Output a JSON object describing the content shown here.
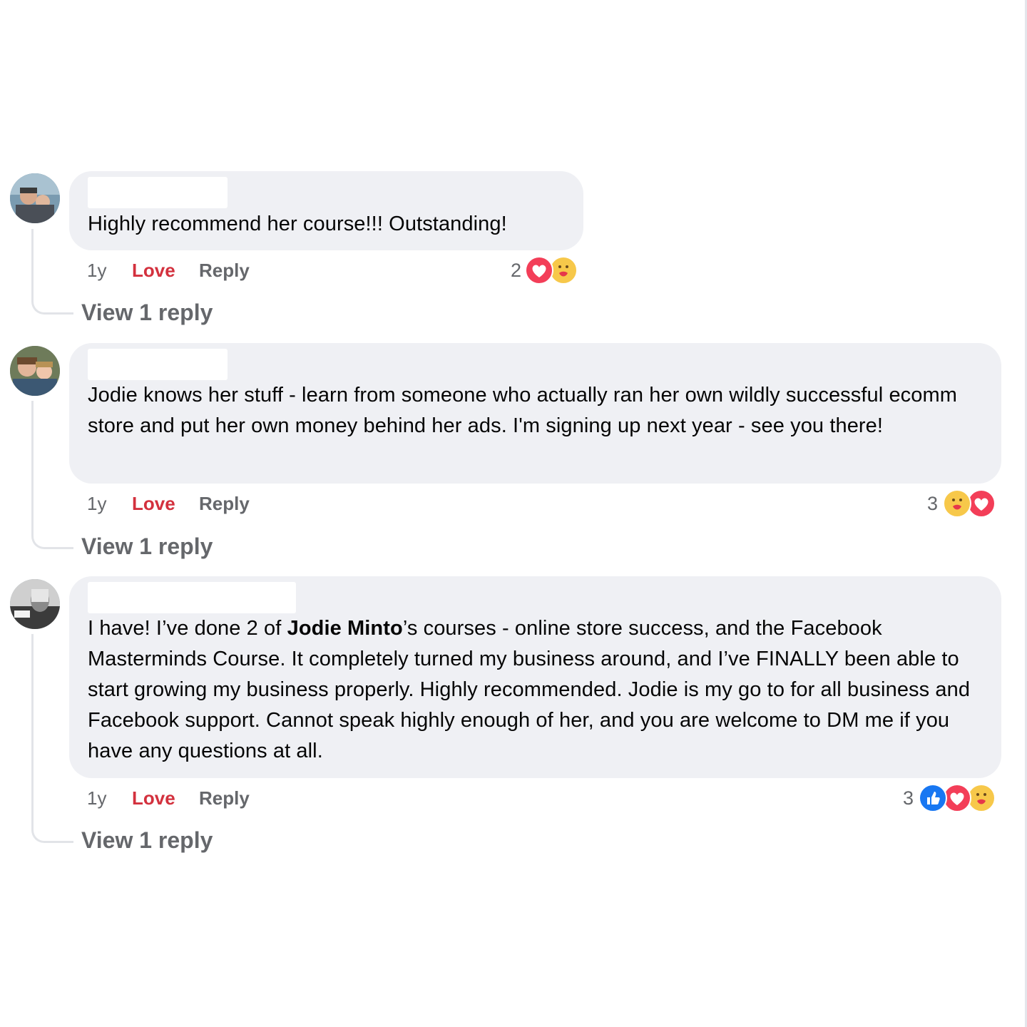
{
  "comments": [
    {
      "text": "Highly recommend her course!!! Outstanding!",
      "time": "1y",
      "love_label": "Love",
      "reply_label": "Reply",
      "reaction_count": "2",
      "reactions": [
        "love",
        "care"
      ],
      "view_replies": "View 1 reply"
    },
    {
      "text": "Jodie knows her stuff - learn from someone who actually ran her own wildly successful ecomm store and put her own money behind her ads. I'm signing up next year - see you there!",
      "time": "1y",
      "love_label": "Love",
      "reply_label": "Reply",
      "reaction_count": "3",
      "reactions": [
        "care",
        "love"
      ],
      "view_replies": "View 1 reply"
    },
    {
      "text_before": "I have! I’ve done 2 of ",
      "mention": "Jodie Minto",
      "text_after": "’s courses - online store success, and the Facebook Masterminds Course. It completely turned my business around, and I’ve FINALLY been able to start growing my business properly. Highly recommended. Jodie is my go to for all business and Facebook support. Cannot speak highly enough of her, and you are welcome to DM me if you have any questions at all.",
      "time": "1y",
      "love_label": "Love",
      "reply_label": "Reply",
      "reaction_count": "3",
      "reactions": [
        "like",
        "love",
        "care"
      ],
      "view_replies": "View 1 reply"
    }
  ],
  "colors": {
    "bubble_bg": "#eff0f4",
    "love_red": "#d3313e",
    "meta_gray": "#65676b",
    "like_blue": "#1877f2",
    "heart_red": "#f33e58"
  }
}
